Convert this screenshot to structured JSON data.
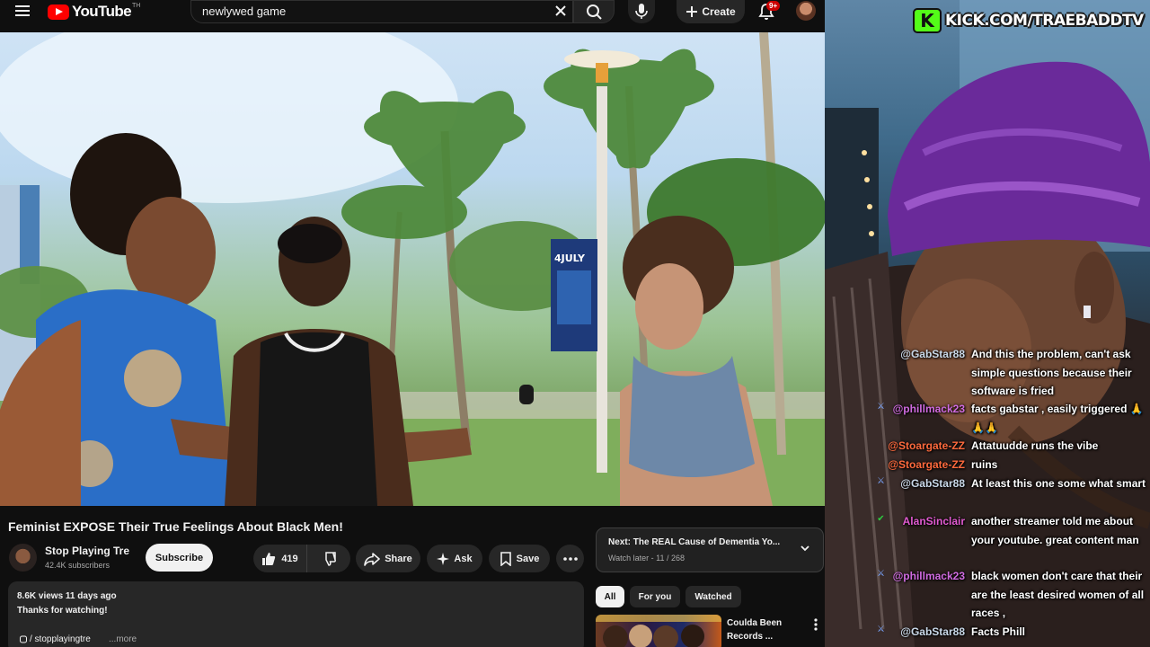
{
  "youtube": {
    "logo_text": "YouTube",
    "logo_country": "TH",
    "search_query": "newlywed game",
    "create_label": "Create",
    "notification_count": "9+",
    "video": {
      "title": "Feminist EXPOSE Their True Feelings About Black Men!",
      "banner_text": "4JULY"
    },
    "channel": {
      "name": "Stop Playing Tre",
      "subscribers": "42.4K subscribers",
      "subscribe_label": "Subscribe"
    },
    "actions": {
      "likes": "419",
      "share": "Share",
      "ask": "Ask",
      "save": "Save"
    },
    "description": {
      "views_date": "8.6K views  11 days ago",
      "text": "Thanks for watching!",
      "link": "/ stopplayingtre",
      "more": "...more"
    },
    "next_up": {
      "title": "Next: The REAL Cause of Dementia Yo...",
      "subtitle": "Watch later - 11 / 268"
    },
    "chips": [
      "All",
      "For you",
      "Watched"
    ],
    "recommendation": {
      "title": "Coulda Been Records ..."
    }
  },
  "stream": {
    "kick_text": "KICK.COM/TRAEBADDTV",
    "kick_logo_letter": "K",
    "chat": [
      {
        "user": "@GabStar88",
        "user_color": "#c9d8e8",
        "badge": "⚔",
        "message": "And this the problem, can't ask simple questions because their software is fried"
      },
      {
        "user": "@phillmack23",
        "user_color": "#d06be0",
        "badge": "⚔",
        "message": "facts gabstar , easily triggered 🙏🙏🙏"
      },
      {
        "user": "@Stoargate-ZZ",
        "user_color": "#ff6a3d",
        "badge": "",
        "message": "Attatuudde runs the vibe"
      },
      {
        "user": "@Stoargate-ZZ",
        "user_color": "#ff6a3d",
        "badge": "",
        "message": "ruins"
      },
      {
        "user": "@GabStar88",
        "user_color": "#c9d8e8",
        "badge": "⚔",
        "message": "At least this one some what smart"
      },
      {
        "user": "AlanSinclair",
        "user_color": "#e05ad0",
        "badge": "✔",
        "message": "another streamer told me about your youtube. great content man"
      },
      {
        "user": "@phillmack23",
        "user_color": "#d06be0",
        "badge": "⚔",
        "message": "black women don't care that their are the least desired women of all races ,"
      },
      {
        "user": "@GabStar88",
        "user_color": "#c9d8e8",
        "badge": "⚔",
        "message": "Facts Phill"
      }
    ]
  },
  "colors": {
    "youtube_red": "#ff0000",
    "kick_green": "#53fc18",
    "background": "#0f0f0f"
  }
}
